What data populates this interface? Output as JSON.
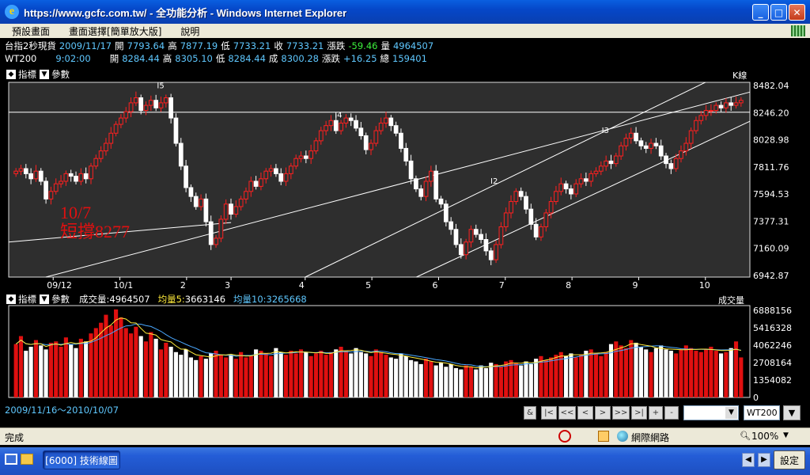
{
  "window": {
    "title": "https://www.gcfc.com.tw/ - 全功能分析 - Windows Internet Explorer",
    "minimize": "_",
    "maximize": "□",
    "close": "✕"
  },
  "menu": [
    "預設畫面",
    "畫面選擇[簡單放大版]",
    "說明"
  ],
  "info_row1": {
    "name": "台指2秒現貨",
    "date": "2009/11/17",
    "open_label": "開",
    "open": "7793.64",
    "high_label": "高",
    "high": "7877.19",
    "low_label": "低",
    "low": "7733.21",
    "close_label": "收",
    "close": "7733.21",
    "chg_label": "漲跌",
    "chg": "-59.46",
    "vol_label": "量",
    "vol": "4964507"
  },
  "info_row2": {
    "name": "WT200",
    "time": "9:02:00",
    "open_label": "開",
    "open": "8284.44",
    "high_label": "高",
    "high": "8305.10",
    "low_label": "低",
    "low": "8284.44",
    "trade_label": "成",
    "trade": "8300.28",
    "chg_label": "漲跌",
    "chg": "+16.25",
    "total_label": "總",
    "total": "159401"
  },
  "price_panel": {
    "indicator_label": "指標",
    "param_label": "參數",
    "kline_label": "K線",
    "annotation_date": "10/7",
    "annotation_text": "短撐8277",
    "wave_labels": [
      "I5",
      "I4",
      "I3",
      "I2"
    ]
  },
  "volume_panel": {
    "indicator_label": "指標",
    "param_label": "參數",
    "vol_label": "成交量:",
    "vol": "4964507",
    "ma5_label": "均量5:",
    "ma5": "3663146",
    "ma10_label": "均量10:",
    "ma10": "3265668",
    "right_label": "成交量"
  },
  "chart_data": [
    {
      "type": "candlestick",
      "x_ticks": [
        "09/12",
        "10/1",
        "2",
        "3",
        "4",
        "5",
        "6",
        "7",
        "8",
        "9",
        "10"
      ],
      "y_ticks": [
        "8482.04",
        "8246.20",
        "8028.98",
        "7811.76",
        "7594.53",
        "7377.31",
        "7160.09",
        "6942.87"
      ],
      "ylim": [
        6942.87,
        8482.04
      ],
      "horizontal_lines": [
        8246.2
      ],
      "close_series": [
        7780,
        7800,
        7760,
        7720,
        7780,
        7700,
        7560,
        7620,
        7680,
        7700,
        7760,
        7740,
        7700,
        7760,
        7720,
        7820,
        7880,
        7940,
        8000,
        8080,
        8150,
        8200,
        8250,
        8320,
        8360,
        8260,
        8300,
        8340,
        8280,
        8320,
        8360,
        8200,
        8000,
        7820,
        7650,
        7580,
        7500,
        7560,
        7380,
        7200,
        7250,
        7400,
        7520,
        7440,
        7500,
        7560,
        7620,
        7700,
        7660,
        7720,
        7780,
        7800,
        7760,
        7700,
        7760,
        7820,
        7880,
        7900,
        7880,
        7940,
        8020,
        8100,
        8140,
        8180,
        8100,
        8160,
        8200,
        8180,
        8120,
        8060,
        7950,
        8000,
        8100,
        8160,
        8200,
        8140,
        8080,
        7960,
        7860,
        7720,
        7640,
        7580,
        7700,
        7780,
        7560,
        7520,
        7380,
        7320,
        7200,
        7120,
        7220,
        7320,
        7280,
        7240,
        7150,
        7080,
        7200,
        7340,
        7450,
        7540,
        7620,
        7580,
        7480,
        7360,
        7260,
        7340,
        7450,
        7540,
        7620,
        7680,
        7640,
        7600,
        7680,
        7720,
        7700,
        7760,
        7780,
        7820,
        7860,
        7840,
        7900,
        7980,
        8040,
        8080,
        8020,
        7980,
        7960,
        8000,
        7980,
        7900,
        7840,
        7800,
        7880,
        7940,
        8000,
        8100,
        8180,
        8220,
        8260,
        8260,
        8300,
        8280,
        8320,
        8300,
        8320,
        8340
      ]
    },
    {
      "type": "bar",
      "y_ticks": [
        "6888156",
        "5416328",
        "4062246",
        "2708164",
        "1354082",
        "0"
      ],
      "ylim": [
        0,
        6888156
      ],
      "volumes": [
        4000000,
        4600000,
        3500000,
        3800000,
        4300000,
        3900000,
        3600000,
        4100000,
        4200000,
        3800000,
        4500000,
        4000000,
        3700000,
        4400000,
        4200000,
        4800000,
        5200000,
        5600000,
        6200000,
        5400000,
        6600000,
        6000000,
        5200000,
        4800000,
        5300000,
        4600000,
        4200000,
        4900000,
        4400000,
        3600000,
        4100000,
        3800000,
        3400000,
        3200000,
        3600000,
        3000000,
        2800000,
        3100000,
        2900000,
        3300000,
        3500000,
        3200000,
        3000000,
        3200000,
        2900000,
        3400000,
        3000000,
        3100000,
        3600000,
        3500000,
        3300000,
        3100000,
        3700000,
        3400000,
        3200000,
        3500000,
        3300000,
        3600000,
        3400000,
        3100000,
        3300000,
        3500000,
        3200000,
        3400000,
        3600000,
        3800000,
        3500000,
        3300000,
        3700000,
        3400000,
        3300000,
        3100000,
        3600000,
        3400000,
        3200000,
        3000000,
        2900000,
        3300000,
        3100000,
        2800000,
        2700000,
        2500000,
        2900000,
        2700000,
        2400000,
        2600000,
        2300000,
        2500000,
        2200000,
        2100000,
        2400000,
        2300000,
        2100000,
        2400000,
        2200000,
        2600000,
        2500000,
        2300000,
        2700000,
        2800000,
        2600000,
        2400000,
        2700000,
        2500000,
        2900000,
        3100000,
        2800000,
        3000000,
        3200000,
        3400000,
        3100000,
        3300000,
        3000000,
        3200000,
        3500000,
        3600000,
        3300000,
        3100000,
        3400000,
        4000000,
        4200000,
        3900000,
        3700000,
        4300000,
        4100000,
        3800000,
        3600000,
        3400000,
        3700000,
        3900000,
        3600000,
        3500000,
        3300000,
        3600000,
        3900000,
        3700000,
        3500000,
        3400000,
        3600000,
        3800000,
        3500000,
        3300000,
        3400000,
        3700000,
        4200000,
        3000000
      ]
    }
  ],
  "bottom": {
    "range": "2009/11/16～2010/10/07",
    "nav_buttons": [
      "&",
      "|<",
      "<<",
      "<",
      ">",
      ">>",
      ">|",
      "+",
      "-"
    ],
    "symbol": "WT200"
  },
  "status": {
    "text": "完成",
    "zone": "網際網路",
    "zoom": "100%"
  },
  "taskbar": {
    "task_label": "[6000] 技術線圖",
    "settings_label": "設定"
  }
}
